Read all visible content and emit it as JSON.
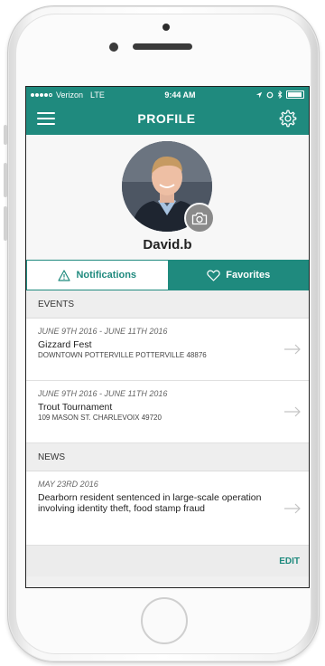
{
  "status_bar": {
    "carrier": "Verizon",
    "network": "LTE",
    "time": "9:44 AM"
  },
  "nav": {
    "title": "PROFILE"
  },
  "profile": {
    "username": "David.b"
  },
  "tabs": [
    {
      "label": "Notifications",
      "icon": "warning-icon",
      "active": true
    },
    {
      "label": "Favorites",
      "icon": "heart-icon",
      "active": false
    }
  ],
  "events": {
    "header": "EVENTS",
    "items": [
      {
        "date": "JUNE 9TH 2016 - JUNE 11TH 2016",
        "title": "Gizzard Fest",
        "address": "DOWNTOWN POTTERVILLE POTTERVILLE 48876"
      },
      {
        "date": "JUNE 9TH 2016 - JUNE 11TH 2016",
        "title": "Trout Tournament",
        "address": "109 MASON ST. CHARLEVOIX 49720"
      }
    ]
  },
  "news": {
    "header": "NEWS",
    "items": [
      {
        "date": "MAY 23RD 2016",
        "title": "Dearborn resident sentenced in large-scale operation involving identity theft, food stamp fraud"
      }
    ]
  },
  "footer": {
    "edit_label": "EDIT"
  },
  "colors": {
    "accent": "#1f8a7e"
  }
}
